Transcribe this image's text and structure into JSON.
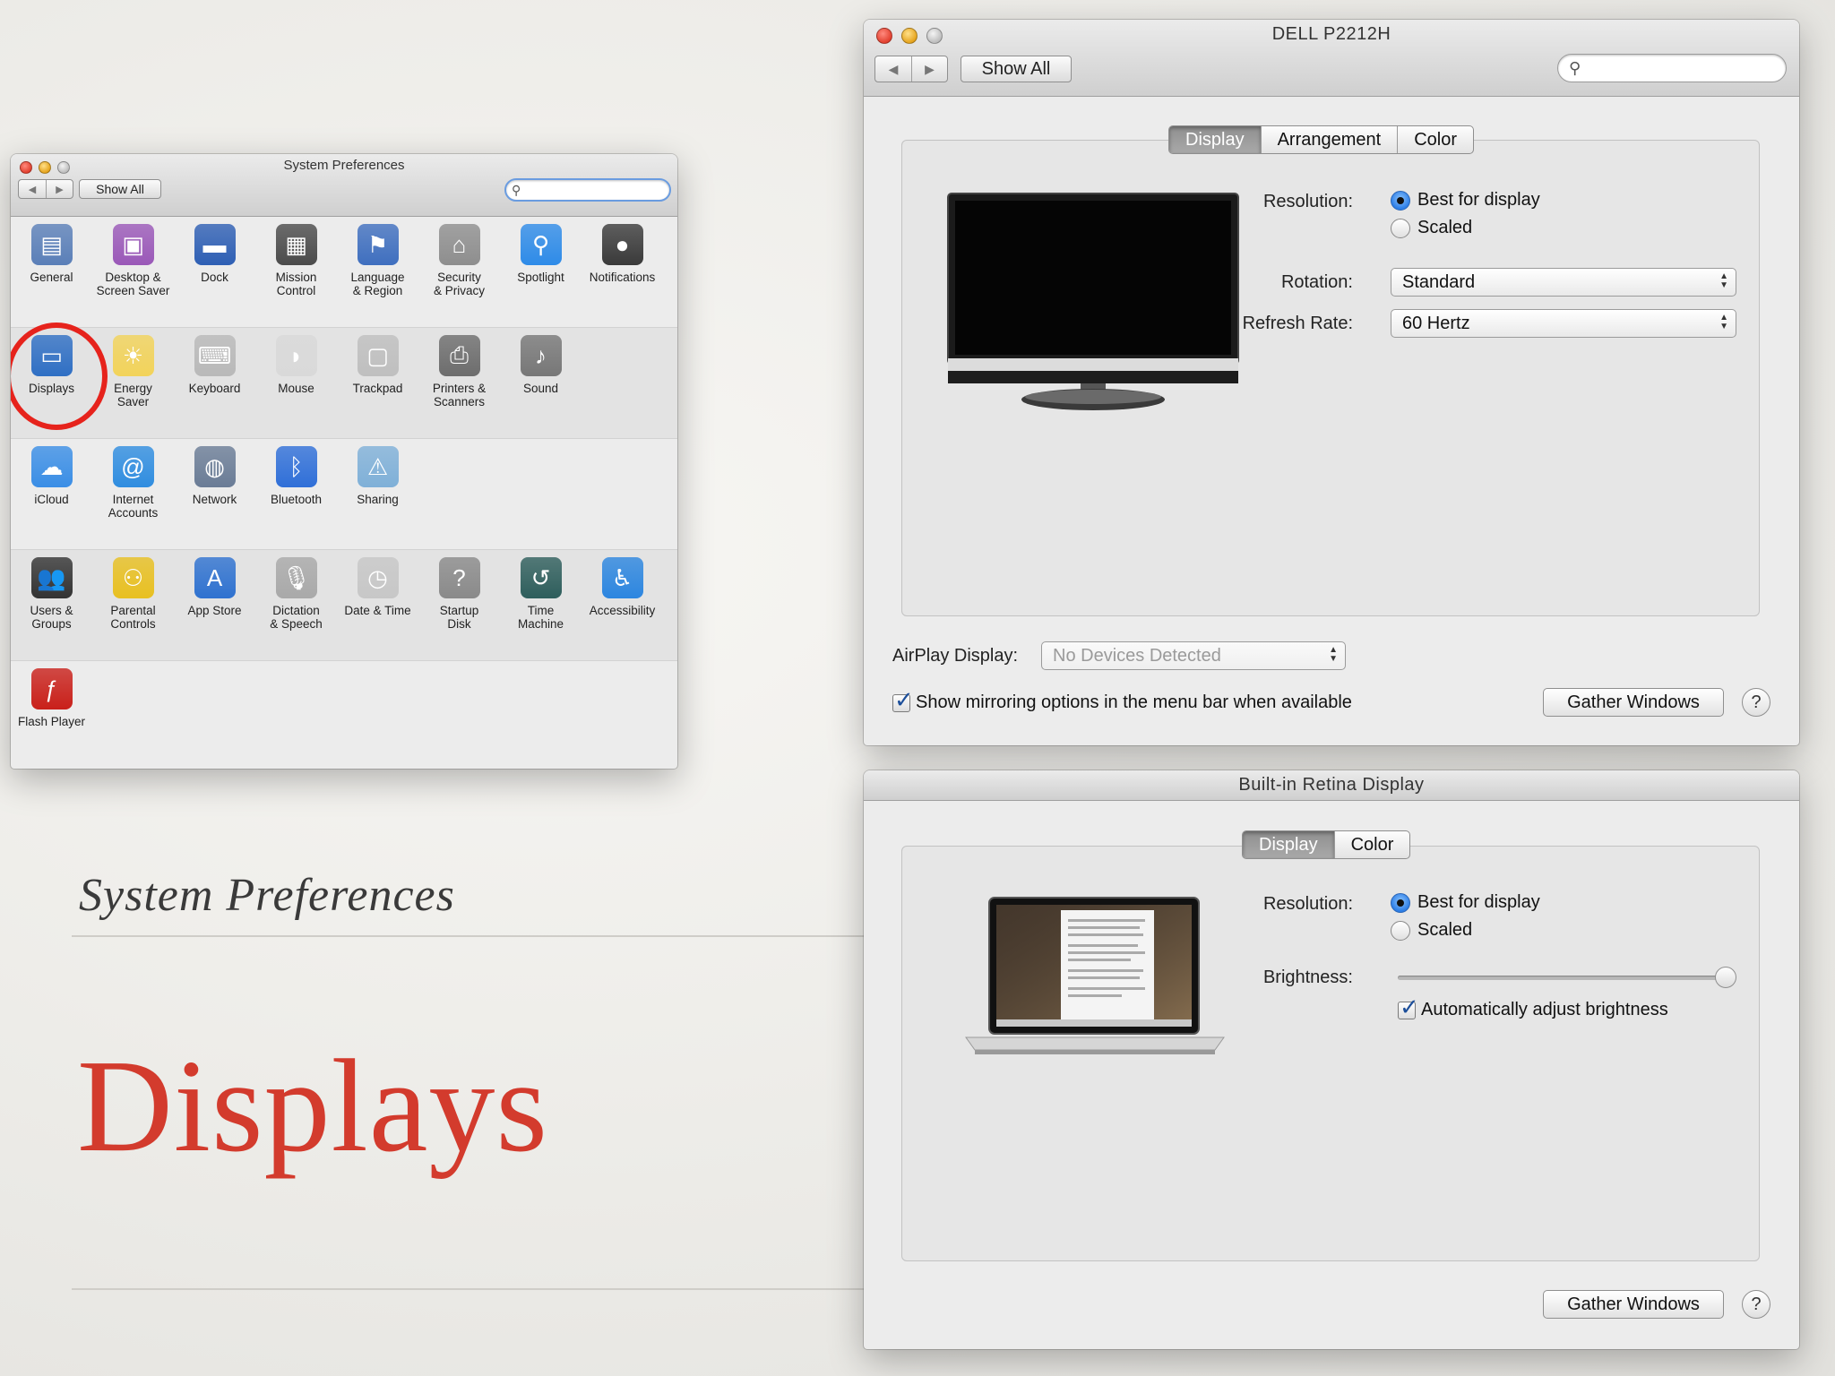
{
  "slide": {
    "subtitle": "System Preferences",
    "title": "Displays"
  },
  "sysprefs": {
    "title": "System Preferences",
    "show_all": "Show All",
    "search_placeholder": "",
    "rows": [
      [
        {
          "label": "General",
          "icon": "general-icon",
          "color": "#5a7fb8",
          "glyph": "▤"
        },
        {
          "label": "Desktop &\nScreen Saver",
          "icon": "desktop-screensaver-icon",
          "color": "#9a58b8",
          "glyph": "▣"
        },
        {
          "label": "Dock",
          "icon": "dock-icon",
          "color": "#2e5fb4",
          "glyph": "▬"
        },
        {
          "label": "Mission\nControl",
          "icon": "mission-control-icon",
          "color": "#4b4b4b",
          "glyph": "▦"
        },
        {
          "label": "Language\n& Region",
          "icon": "language-region-icon",
          "color": "#3f6fbf",
          "glyph": "⚑"
        },
        {
          "label": "Security\n& Privacy",
          "icon": "security-privacy-icon",
          "color": "#8e8e8e",
          "glyph": "⌂"
        },
        {
          "label": "Spotlight",
          "icon": "spotlight-icon",
          "color": "#2e8be8",
          "glyph": "⚲"
        },
        {
          "label": "Notifications",
          "icon": "notifications-icon",
          "color": "#3a3a3a",
          "glyph": "●"
        }
      ],
      [
        {
          "label": "Displays",
          "icon": "displays-icon",
          "color": "#2f6fc4",
          "glyph": "▭"
        },
        {
          "label": "Energy\nSaver",
          "icon": "energy-saver-icon",
          "color": "#f2d35a",
          "glyph": "☀"
        },
        {
          "label": "Keyboard",
          "icon": "keyboard-icon",
          "color": "#b9b9b9",
          "glyph": "⌨"
        },
        {
          "label": "Mouse",
          "icon": "mouse-icon",
          "color": "#d9d9d9",
          "glyph": "◗"
        },
        {
          "label": "Trackpad",
          "icon": "trackpad-icon",
          "color": "#bfbfbf",
          "glyph": "▢"
        },
        {
          "label": "Printers &\nScanners",
          "icon": "printers-scanners-icon",
          "color": "#6d6d6d",
          "glyph": "⎙"
        },
        {
          "label": "Sound",
          "icon": "sound-icon",
          "color": "#777777",
          "glyph": "♪"
        }
      ],
      [
        {
          "label": "iCloud",
          "icon": "icloud-icon",
          "color": "#3a8ee6",
          "glyph": "☁"
        },
        {
          "label": "Internet\nAccounts",
          "icon": "internet-accounts-icon",
          "color": "#2f8de0",
          "glyph": "@"
        },
        {
          "label": "Network",
          "icon": "network-icon",
          "color": "#6a7c96",
          "glyph": "◍"
        },
        {
          "label": "Bluetooth",
          "icon": "bluetooth-icon",
          "color": "#2f6fd8",
          "glyph": "ᛒ"
        },
        {
          "label": "Sharing",
          "icon": "sharing-icon",
          "color": "#7fb0d8",
          "glyph": "⚠"
        }
      ],
      [
        {
          "label": "Users &\nGroups",
          "icon": "users-groups-icon",
          "color": "#333333",
          "glyph": "👥"
        },
        {
          "label": "Parental\nControls",
          "icon": "parental-controls-icon",
          "color": "#e8c021",
          "glyph": "⚇"
        },
        {
          "label": "App Store",
          "icon": "app-store-icon",
          "color": "#2f72d0",
          "glyph": "A"
        },
        {
          "label": "Dictation\n& Speech",
          "icon": "dictation-speech-icon",
          "color": "#a9a9a9",
          "glyph": "🎙"
        },
        {
          "label": "Date & Time",
          "icon": "date-time-icon",
          "color": "#c7c7c7",
          "glyph": "◷"
        },
        {
          "label": "Startup\nDisk",
          "icon": "startup-disk-icon",
          "color": "#8a8a8a",
          "glyph": "?"
        },
        {
          "label": "Time\nMachine",
          "icon": "time-machine-icon",
          "color": "#2e5e5c",
          "glyph": "↺"
        },
        {
          "label": "Accessibility",
          "icon": "accessibility-icon",
          "color": "#2c86e0",
          "glyph": "♿"
        }
      ],
      [
        {
          "label": "Flash Player",
          "icon": "flash-player-icon",
          "color": "#c9201a",
          "glyph": "ƒ"
        }
      ]
    ]
  },
  "dell_window": {
    "title": "DELL P2212H",
    "show_all": "Show All",
    "tabs": [
      "Display",
      "Arrangement",
      "Color"
    ],
    "resolution_label": "Resolution:",
    "resolution_options": [
      "Best for display",
      "Scaled"
    ],
    "rotation_label": "Rotation:",
    "rotation_value": "Standard",
    "refresh_label": "Refresh Rate:",
    "refresh_value": "60 Hertz",
    "airplay_label": "AirPlay Display:",
    "airplay_value": "No Devices Detected",
    "mirroring_label": "Show mirroring options in the menu bar when available",
    "gather_windows": "Gather Windows",
    "help": "?"
  },
  "retina_window": {
    "title": "Built-in Retina Display",
    "tabs": [
      "Display",
      "Color"
    ],
    "resolution_label": "Resolution:",
    "resolution_options": [
      "Best for display",
      "Scaled"
    ],
    "brightness_label": "Brightness:",
    "brightness_level": 1.0,
    "auto_brightness_label": "Automatically adjust brightness",
    "gather_windows": "Gather Windows",
    "help": "?"
  }
}
